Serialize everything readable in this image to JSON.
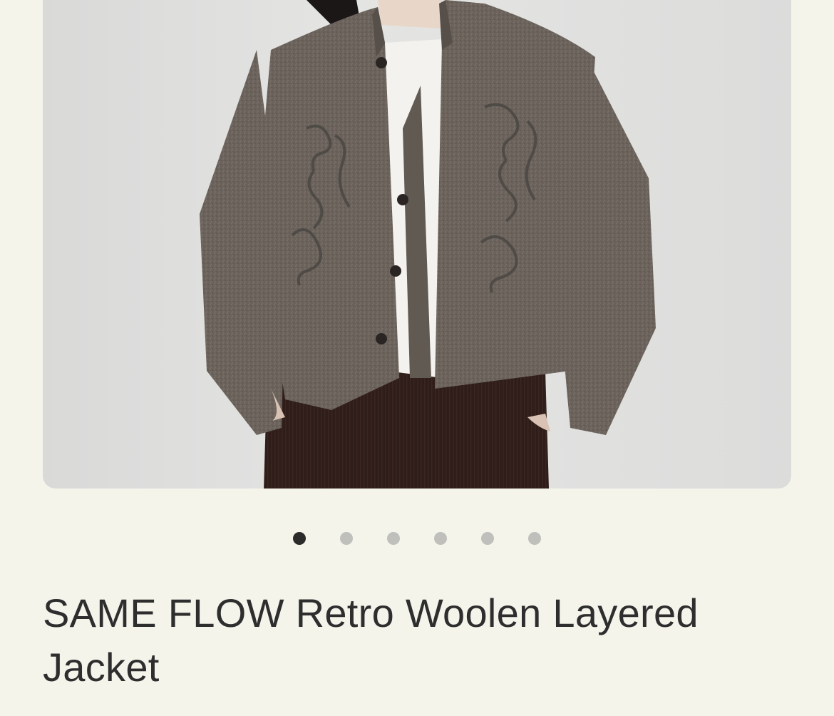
{
  "product": {
    "title": "SAME FLOW Retro Woolen Layered Jacket"
  },
  "gallery": {
    "image_count": 6,
    "active_index": 0,
    "image_subject": "gray woolen jacket with embroidery"
  },
  "colors": {
    "background": "#f5f4eb",
    "dot_active": "#2b2b2b",
    "dot_inactive": "#bfbfbc",
    "title_text": "#2e2e2e"
  }
}
